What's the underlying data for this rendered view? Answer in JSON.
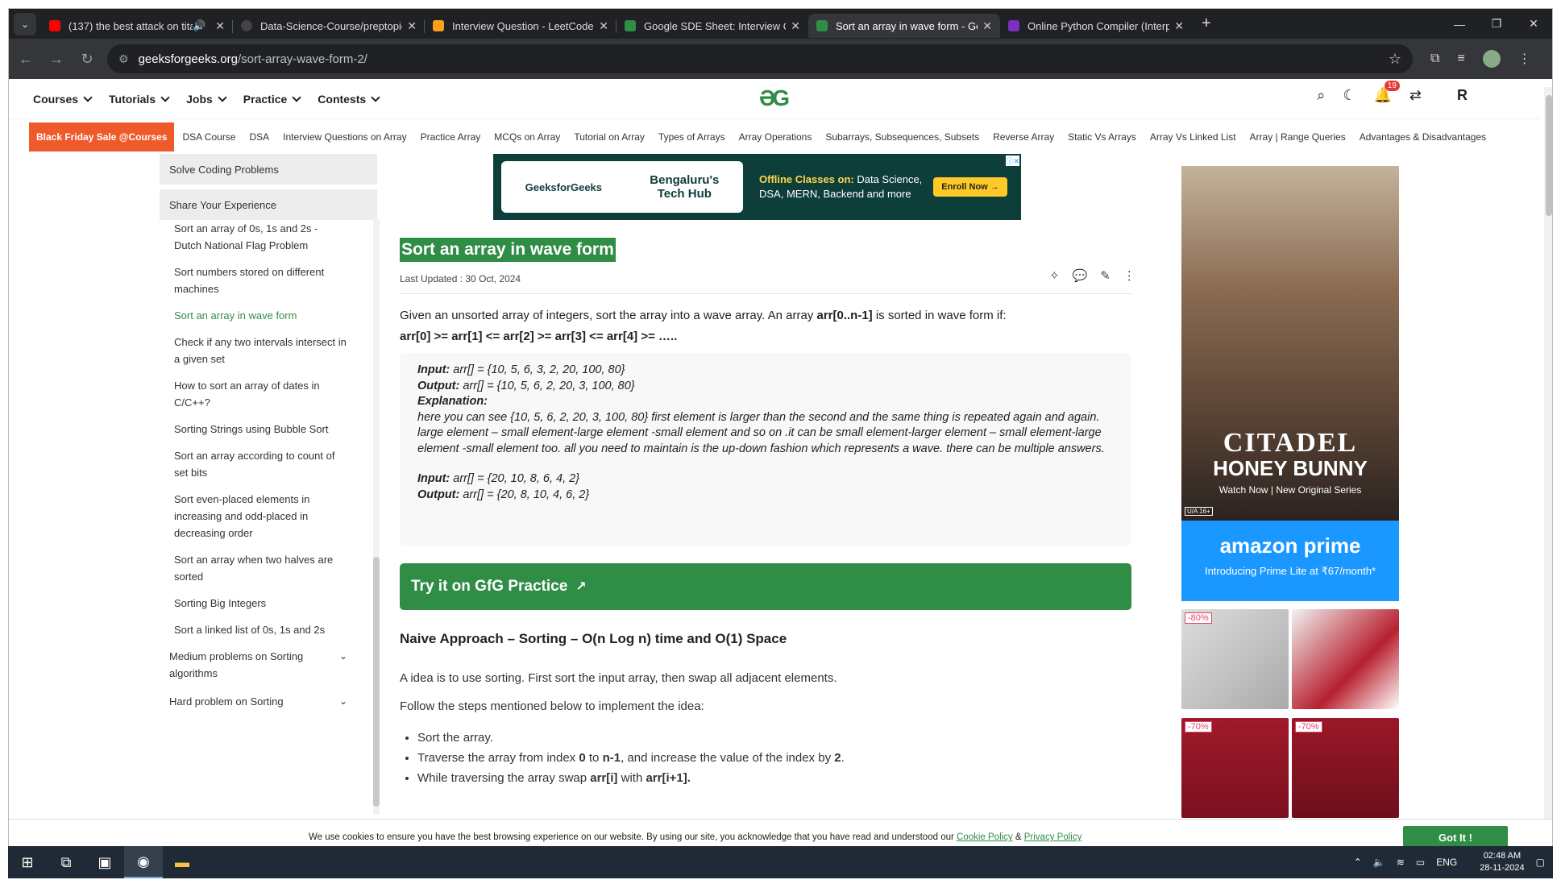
{
  "browser": {
    "tabs": [
      {
        "title": "(137) the best attack on tita",
        "icon": "youtube-icon",
        "color": "#ff0000"
      },
      {
        "title": "Data-Science-Course/preptopic",
        "icon": "github-icon",
        "color": "#222222"
      },
      {
        "title": "Interview Question - LeetCode",
        "icon": "leetcode-icon",
        "color": "#f89f1b"
      },
      {
        "title": "Google SDE Sheet: Interview Qu",
        "icon": "gfg-icon",
        "color": "#2f8d46"
      },
      {
        "title": "Sort an array in wave form - Ge",
        "icon": "gfg-icon",
        "color": "#2f8d46"
      },
      {
        "title": "Online Python Compiler (Interp",
        "icon": "python-icon",
        "color": "#7b2fbe"
      }
    ],
    "new_tab": "+",
    "url_host": "geeksforgeeks.org",
    "url_path": "/sort-array-wave-form-2/"
  },
  "site": {
    "menu": [
      "Courses",
      "Tutorials",
      "Jobs",
      "Practice",
      "Contests"
    ],
    "logo_glyph": "ƏG",
    "notif_count": "19",
    "avatar": "R",
    "promo": "Black Friday Sale @Courses",
    "subnav": [
      "DSA Course",
      "DSA",
      "Interview Questions on Array",
      "Practice Array",
      "MCQs on Array",
      "Tutorial on Array",
      "Types of Arrays",
      "Array Operations",
      "Subarrays, Subsequences, Subsets",
      "Reverse Array",
      "Static Vs Arrays",
      "Array Vs Linked List",
      "Array | Range Queries",
      "Advantages & Disadvantages"
    ]
  },
  "sidebar": {
    "headers": [
      "Solve Coding Problems",
      "Share Your Experience"
    ],
    "items": [
      "Sort an array of 0s, 1s and 2s - Dutch National Flag Problem",
      "Sort numbers stored on different machines",
      "Sort an array in wave form",
      "Check if any two intervals intersect in a given set",
      "How to sort an array of dates in C/C++?",
      "Sorting Strings using Bubble Sort",
      "Sort an array according to count of set bits",
      "Sort even-placed elements in increasing and odd-placed in decreasing order",
      "Sort an array when two halves are sorted",
      "Sorting Big Integers",
      "Sort a linked list of 0s, 1s and 2s"
    ],
    "sections": [
      "Medium problems on Sorting algorithms",
      "Hard problem on Sorting"
    ]
  },
  "ad_banner": {
    "brand": "GeeksforGeeks",
    "hub_line1": "Bengaluru's",
    "hub_line2": "Tech Hub",
    "offline_label": "Offline Classes on:",
    "offline_text": " Data Science,",
    "offline_line2": "DSA, MERN, Backend and more",
    "enroll": "Enroll Now →"
  },
  "article": {
    "title": "Sort an array in wave form",
    "updated": "Last Updated : 30 Oct, 2024",
    "intro_1": "Given an unsorted array of integers, sort the array into a wave array. An array ",
    "intro_bold": "arr[0..n-1]",
    "intro_2": " is sorted in wave form if:",
    "intro_formula": "arr[0] >= arr[1] <= arr[2] >= arr[3] <= arr[4] >= …..",
    "ex1_input_label": "Input:",
    "ex1_input": "  arr[] = {10, 5, 6, 3, 2, 20, 100, 80}",
    "ex1_output_label": "Output:",
    "ex1_output": " arr[] = {10, 5, 6, 2, 20, 3, 100, 80}",
    "explanation_label": "Explanation:",
    "explanation": "here you can see {10, 5, 6, 2, 20, 3, 100, 80} first element is larger than the second and the same thing is repeated again and again. large element – small element-large element -small element and so on .it can be small element-larger element – small element-large element -small element too. all you need to maintain is the up-down fashion which represents a wave. there can be multiple answers.",
    "ex2_input_label": "Input:",
    "ex2_input": " arr[] = {20, 10, 8, 6, 4, 2}",
    "ex2_output_label": "Output:",
    "ex2_output": " arr[] = {20, 8, 10, 4, 6, 2}",
    "try_button": "Try it on GfG Practice",
    "approach_heading": "Naive Approach – Sorting – O(n Log n) time and O(1) Space",
    "idea": "A idea is to use sorting. First sort the input array, then swap all adjacent elements.",
    "follow": "Follow the steps mentioned below to implement the idea:",
    "step1": "Sort the array.",
    "step2_a": "Traverse the array from index ",
    "step2_b": "0",
    "step2_c": " to ",
    "step2_d": "n-1",
    "step2_e": ", and increase the value of the index by ",
    "step2_f": "2",
    "step2_g": ".",
    "step3_a": "While traversing the array swap ",
    "step3_b": "arr[i]",
    "step3_c": " with ",
    "step3_d": "arr[i+1]."
  },
  "right_ad": {
    "title1": "CITADEL",
    "title2": "HONEY BUNNY",
    "tagline": "Watch Now | New Original Series",
    "rating": "U/A 16+",
    "prime": "amazon prime",
    "prime_sub": "Introducing Prime Lite at ₹67/month*",
    "discounts": [
      "-80%",
      "",
      "-70%",
      "-70%"
    ]
  },
  "cookie": {
    "text": "We use cookies to ensure you have the best browsing experience on our website. By using our site, you acknowledge that you have read and understood our ",
    "cookie_link": "Cookie Policy",
    "amp": " & ",
    "privacy_link": "Privacy Policy",
    "button": "Got It !"
  },
  "taskbar": {
    "lang": "ENG",
    "time": "02:48 AM",
    "date": "28-11-2024"
  }
}
